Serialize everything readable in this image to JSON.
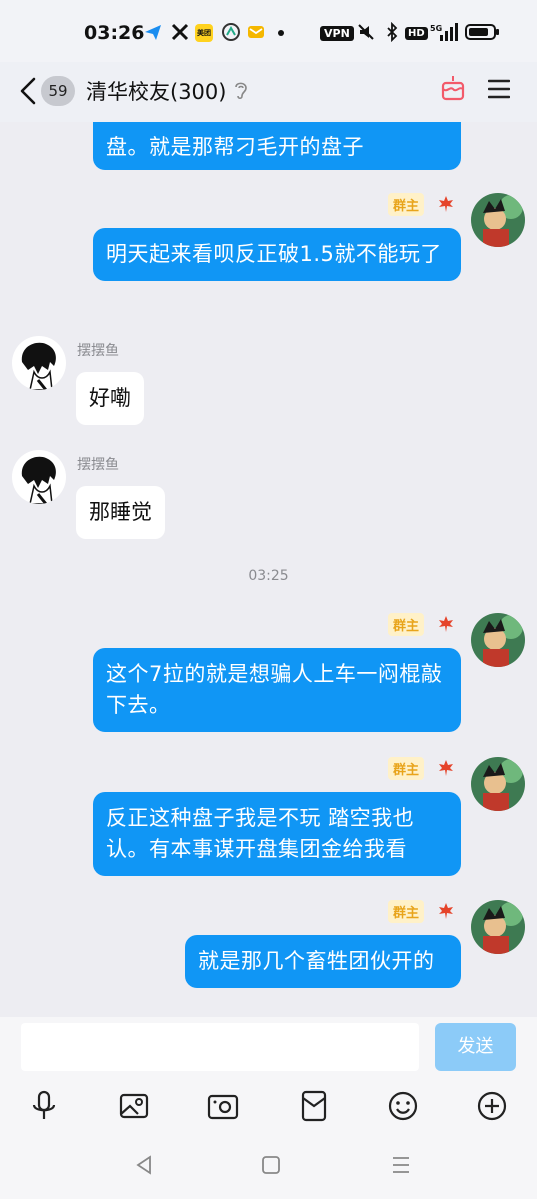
{
  "status_bar": {
    "time": "03:26",
    "vpn": "VPN",
    "hd": "HD",
    "meituan": "美团",
    "network": "5G"
  },
  "header": {
    "unread_count": "59",
    "title": "清华校友(300)"
  },
  "messages": {
    "m0": {
      "text": "盘。就是那帮刁毛开的盘子"
    },
    "m1": {
      "badge": "群主",
      "text": "明天起来看呗反正破1.5就不能玩了"
    },
    "m2": {
      "sender": "摆摆鱼",
      "text": "好嘞"
    },
    "m3": {
      "sender": "摆摆鱼",
      "text": "那睡觉"
    },
    "timestamp": "03:25",
    "m4": {
      "badge": "群主",
      "text": "这个7拉的就是想骗人上车一闷棍敲下去。"
    },
    "m5": {
      "badge": "群主",
      "text": "反正这种盘子我是不玩 踏空我也认。有本事谋开盘集团金给我看"
    },
    "m6": {
      "badge": "群主",
      "text": "就是那几个畜牲团伙开的"
    }
  },
  "input": {
    "value": "",
    "send_label": "发送"
  },
  "colors": {
    "accent": "#1096F5",
    "send_disabled": "#8CCBF8",
    "owner_badge_bg": "#FFF1C8",
    "owner_badge_text": "#E8A41B",
    "background": "#EDEDF2"
  }
}
